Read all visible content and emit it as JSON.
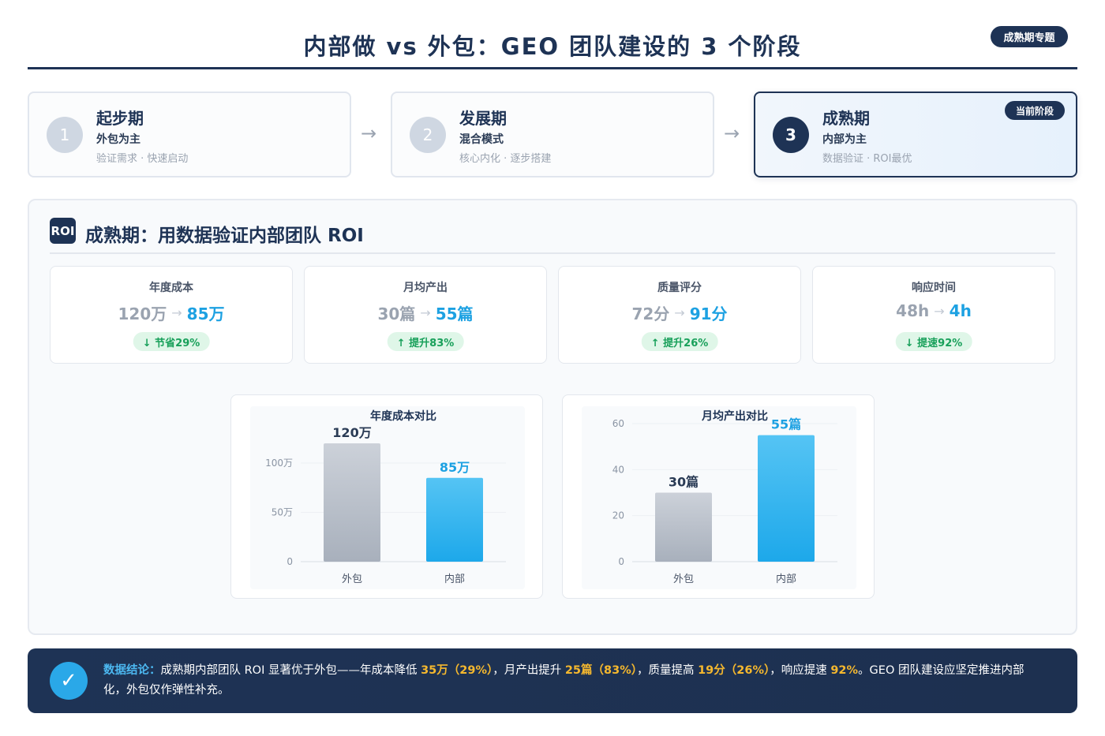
{
  "header": {
    "title": "内部做 vs 外包：GEO 团队建设的 3 个阶段",
    "badge": "成熟期专题"
  },
  "stages": [
    {
      "num": "1",
      "name": "起步期",
      "mode": "外包为主",
      "desc": "验证需求 · 快速启动"
    },
    {
      "num": "2",
      "name": "发展期",
      "mode": "混合模式",
      "desc": "核心内化 · 逐步搭建"
    },
    {
      "num": "3",
      "name": "成熟期",
      "mode": "内部为主",
      "desc": "数据验证 · ROI最优",
      "badge": "当前阶段"
    }
  ],
  "stage_arrow": "→",
  "section": {
    "icon_text": "ROI",
    "title": "成熟期：用数据验证内部团队 ROI"
  },
  "metrics": [
    {
      "label": "年度成本",
      "old": "120万",
      "new": "85万",
      "change": "↓ 节省29%"
    },
    {
      "label": "月均产出",
      "old": "30篇",
      "new": "55篇",
      "change": "↑ 提升83%"
    },
    {
      "label": "质量评分",
      "old": "72分",
      "new": "91分",
      "change": "↑ 提升26%"
    },
    {
      "label": "响应时间",
      "old": "48h",
      "new": "4h",
      "change": "↓ 提速92%"
    }
  ],
  "metric_arrow": "→",
  "chart_data": [
    {
      "type": "bar",
      "title": "年度成本对比",
      "categories": [
        "外包",
        "内部"
      ],
      "values": [
        120,
        85
      ],
      "data_labels": [
        "120万",
        "85万"
      ],
      "yticks": [
        0,
        50,
        100
      ],
      "ytick_labels": [
        "0",
        "50万",
        "100万"
      ],
      "ylim": [
        0,
        140
      ],
      "colors": [
        "#a8b0bc",
        "#1da8ea"
      ],
      "grid": true
    },
    {
      "type": "bar",
      "title": "月均产出对比",
      "categories": [
        "外包",
        "内部"
      ],
      "values": [
        30,
        55
      ],
      "data_labels": [
        "30篇",
        "55篇"
      ],
      "yticks": [
        0,
        20,
        40,
        60
      ],
      "ytick_labels": [
        "0",
        "20",
        "40",
        "60"
      ],
      "ylim": [
        0,
        60
      ],
      "colors": [
        "#a8b0bc",
        "#1da8ea"
      ],
      "grid": true
    }
  ],
  "conclusion": {
    "lead": "数据结论：",
    "t1": "成熟期内部团队 ROI 显著优于外包——年成本降低 ",
    "h1": "35万（29%）",
    "t2": "，月产出提升 ",
    "h2": "25篇（83%）",
    "t3": "，质量提高 ",
    "h3": "19分（26%）",
    "t4": "，响应提速 ",
    "h4": "92%",
    "t5": "。GEO 团队建设应坚定推进内部化，外包仅作弹性补充。",
    "icon": "✓"
  }
}
